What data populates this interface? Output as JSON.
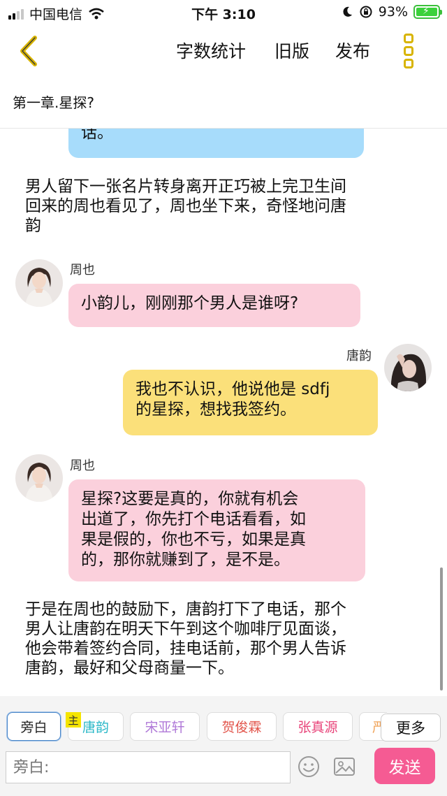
{
  "status_bar": {
    "carrier": "中国电信",
    "time": "下午 3:10",
    "battery_text": "93%",
    "icons": [
      "signal-icon",
      "wifi-icon",
      "moon-icon",
      "rotation-lock-icon",
      "battery-charging-icon"
    ]
  },
  "toolbar": {
    "word_count_label": "字数统计",
    "old_version_label": "旧版",
    "publish_label": "发布"
  },
  "chapter_title": "第一章.星探?",
  "messages": [
    {
      "type": "bubble-partial",
      "text": "话。"
    },
    {
      "type": "narration",
      "lines": [
        "男人留下一张名片转身离开正巧被上完卫生间",
        "回来的周也看见了，周也坐下来，奇怪地问唐",
        "韵"
      ]
    },
    {
      "type": "left",
      "speaker": "周也",
      "lines": [
        "小韵儿，刚刚那个男人是谁呀?"
      ]
    },
    {
      "type": "right",
      "speaker": "唐韵",
      "lines": [
        "我也不认识，他说他是 sdfj",
        "的星探，想找我签约。"
      ]
    },
    {
      "type": "left",
      "speaker": "周也",
      "lines": [
        "星探?这要是真的，你就有机会",
        "出道了，你先打个电话看看，如",
        "果是假的，你也不亏，如果是真",
        "的，那你就赚到了，是不是。"
      ]
    },
    {
      "type": "narration",
      "lines": [
        "于是在周也的鼓励下，唐韵打下了电话，那个",
        "男人让唐韵在明天下午到这个咖啡厅见面谈，",
        "他会带着签约合同，挂电话前，那个男人告诉",
        "唐韵，最好和父母商量一下。"
      ]
    }
  ],
  "roles": [
    {
      "label": "旁白",
      "color": "#222222"
    },
    {
      "label": "唐韵",
      "color": "#2bb8c8"
    },
    {
      "label": "宋亚轩",
      "color": "#b07ad8"
    },
    {
      "label": "贺俊霖",
      "color": "#e2544a"
    },
    {
      "label": "张真源",
      "color": "#e8447a"
    },
    {
      "label": "严",
      "color": "#f0a45a"
    }
  ],
  "owner_badge": "主",
  "more_roles_label": "更多",
  "input": {
    "placeholder": "旁白:"
  },
  "send_label": "发送",
  "colors": {
    "accent_pink": "#f55b93",
    "bubble_pink": "#fbd0dc",
    "bubble_yellow": "#fbe07a",
    "bubble_blue": "#a7dcfb",
    "back_arrow": "#d8b400"
  }
}
